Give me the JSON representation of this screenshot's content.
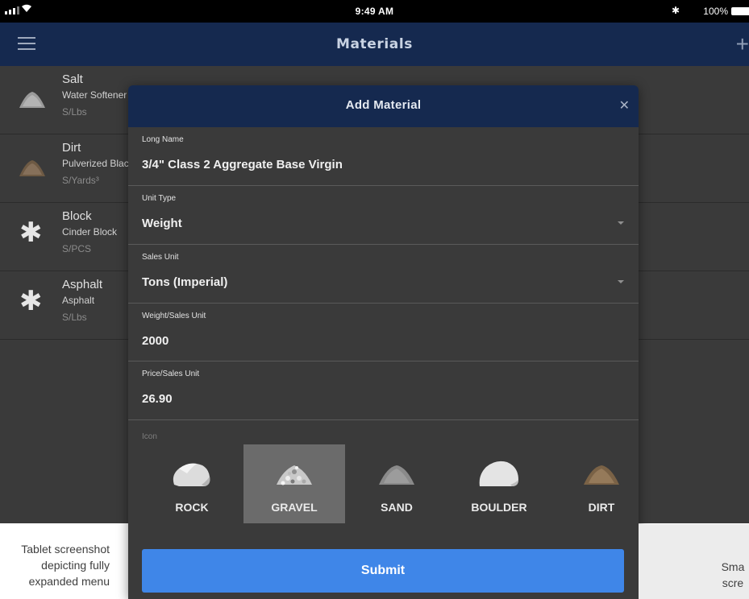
{
  "status_bar": {
    "time": "9:49 AM",
    "battery": "100%"
  },
  "app": {
    "title": "Materials"
  },
  "materials_list": [
    {
      "name": "Salt",
      "description": "Water Softener",
      "unit": "S/Lbs",
      "icon": "salt-pile-icon"
    },
    {
      "name": "Dirt",
      "description": "Pulverized Blac",
      "unit": "S/Yards³",
      "icon": "dirt-pile-icon"
    },
    {
      "name": "Block",
      "description": "Cinder Block",
      "unit": "S/PCS",
      "icon": "asterisk-icon"
    },
    {
      "name": "Asphalt",
      "description": "Asphalt",
      "unit": "S/Lbs",
      "icon": "asterisk-icon"
    }
  ],
  "modal": {
    "title": "Add Material",
    "fields": {
      "long_name": {
        "label": "Long Name",
        "value": "3/4\" Class 2 Aggregate Base Virgin"
      },
      "unit_type": {
        "label": "Unit Type",
        "value": "Weight"
      },
      "sales_unit": {
        "label": "Sales Unit",
        "value": "Tons (Imperial)"
      },
      "weight_per_unit": {
        "label": "Weight/Sales Unit",
        "value": "2000"
      },
      "price_per_unit": {
        "label": "Price/Sales Unit",
        "value": "26.90"
      }
    },
    "icon_label": "Icon",
    "icons": [
      {
        "label": "ROCK",
        "icon": "rock-icon"
      },
      {
        "label": "GRAVEL",
        "icon": "gravel-icon",
        "selected": true
      },
      {
        "label": "SAND",
        "icon": "sand-icon"
      },
      {
        "label": "BOULDER",
        "icon": "boulder-icon"
      },
      {
        "label": "DIRT",
        "icon": "dirt-icon"
      }
    ],
    "submit_label": "Submit"
  },
  "captions": {
    "left": [
      "Tablet screenshot",
      "depicting fully",
      "expanded menu"
    ],
    "right": [
      "Sma",
      "scre"
    ]
  },
  "colors": {
    "nav": "#15294f",
    "background": "#3a3a3a",
    "accent": "#3f86e8",
    "selected_tile": "#6b6b6b"
  }
}
